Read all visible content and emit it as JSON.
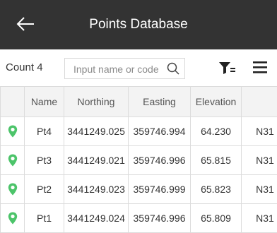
{
  "header": {
    "title": "Points Database",
    "back_icon": "arrow-left-icon"
  },
  "toolbar": {
    "count_label": "Count 4",
    "search_placeholder": "Input name or code",
    "search_value": "",
    "search_icon": "search-icon",
    "filter_icon": "filter-icon",
    "menu_icon": "menu-icon"
  },
  "table": {
    "columns": [
      "",
      "Name",
      "Northing",
      "Easting",
      "Elevation",
      ""
    ],
    "rows": [
      {
        "icon": "map-pin-icon",
        "name": "Pt4",
        "northing": "3441249.025",
        "easting": "359746.994",
        "elevation": "64.230",
        "extra": "N31"
      },
      {
        "icon": "map-pin-icon",
        "name": "Pt3",
        "northing": "3441249.021",
        "easting": "359746.996",
        "elevation": "65.815",
        "extra": "N31"
      },
      {
        "icon": "map-pin-icon",
        "name": "Pt2",
        "northing": "3441249.023",
        "easting": "359746.999",
        "elevation": "65.823",
        "extra": "N31"
      },
      {
        "icon": "map-pin-icon",
        "name": "Pt1",
        "northing": "3441249.024",
        "easting": "359746.996",
        "elevation": "65.809",
        "extra": "N31"
      }
    ]
  },
  "colors": {
    "header_bg": "#333333",
    "pin_green": "#4cc46a",
    "table_header_bg": "#f3f3f3"
  }
}
